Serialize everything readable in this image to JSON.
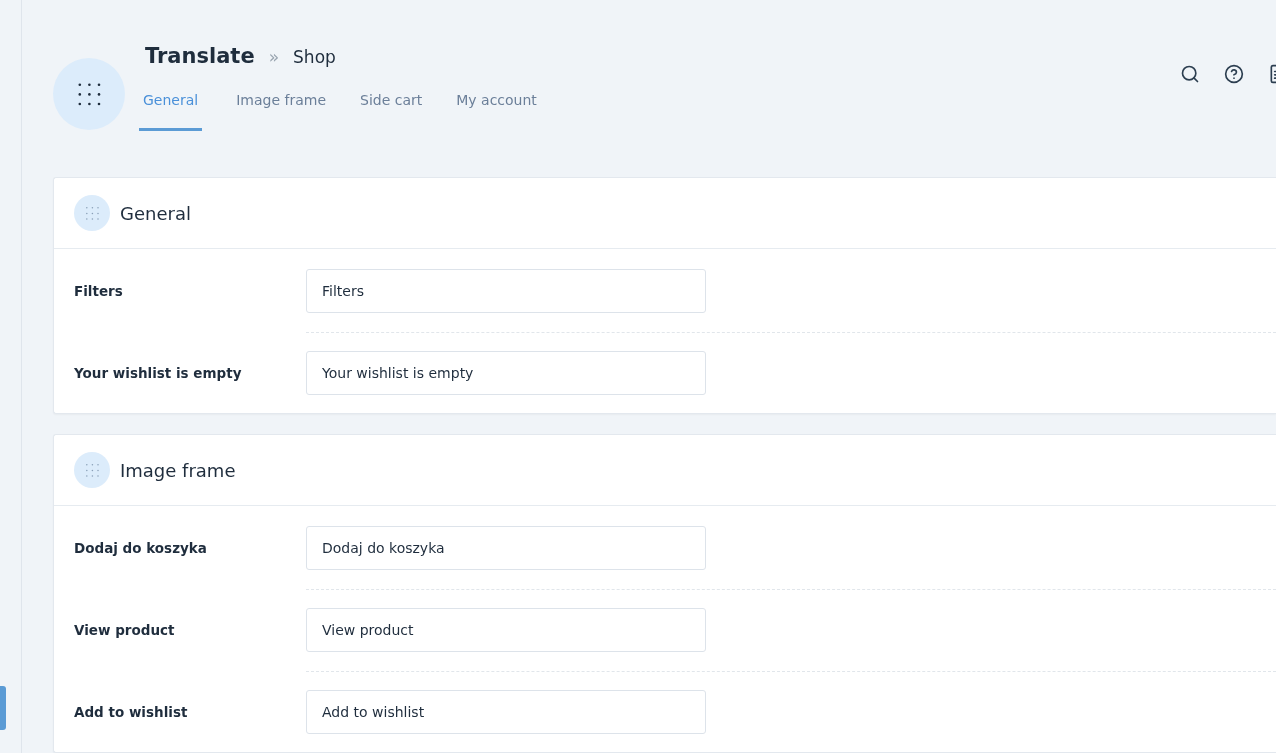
{
  "header": {
    "title": "Translate",
    "separator": "»",
    "subtitle": "Shop"
  },
  "tabs": [
    {
      "label": "General",
      "selected": true
    },
    {
      "label": "Image frame",
      "selected": false
    },
    {
      "label": "Side cart",
      "selected": false
    },
    {
      "label": "My account",
      "selected": false
    }
  ],
  "sections": [
    {
      "title": "General",
      "fields": [
        {
          "label": "Filters",
          "value": "Filters"
        },
        {
          "label": "Your wishlist is empty",
          "value": "Your wishlist is empty"
        }
      ]
    },
    {
      "title": "Image frame",
      "fields": [
        {
          "label": "Dodaj do koszyka",
          "value": "Dodaj do koszyka"
        },
        {
          "label": "View product",
          "value": "View product"
        },
        {
          "label": "Add to wishlist",
          "value": "Add to wishlist"
        }
      ]
    }
  ]
}
